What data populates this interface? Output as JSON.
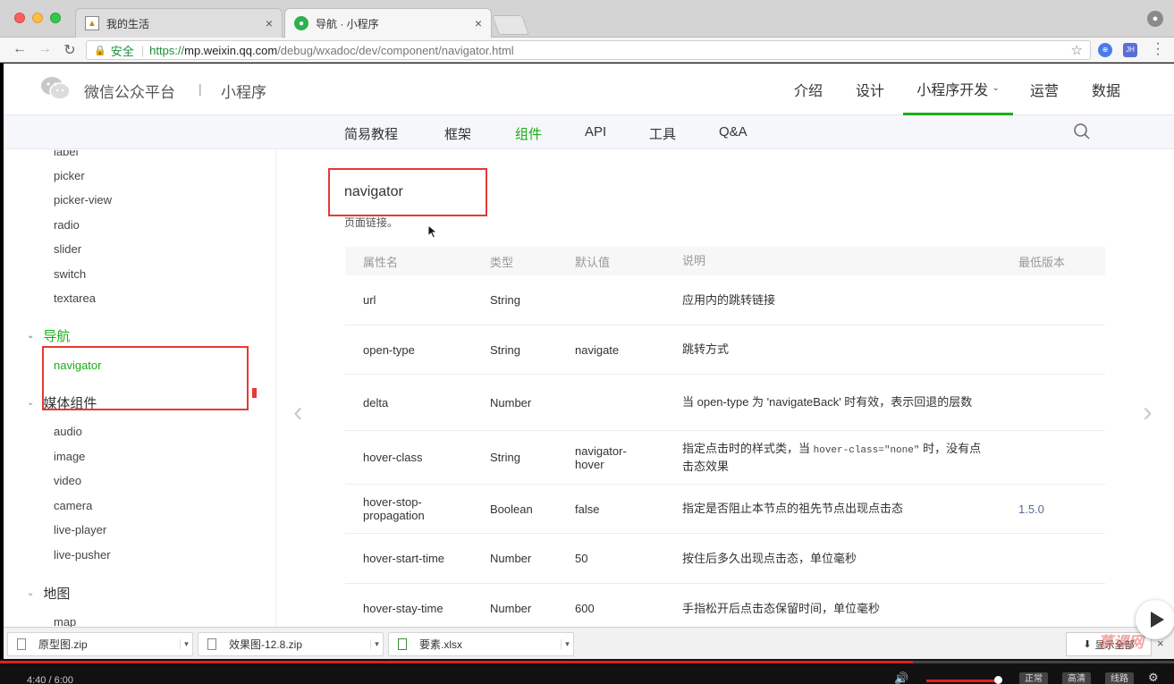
{
  "browser": {
    "tabs": [
      {
        "title": "我的生活",
        "close": "×"
      },
      {
        "title": "导航 · 小程序",
        "close": "×"
      }
    ],
    "secure_label": "安全",
    "url": {
      "proto": "https://",
      "host": "mp.weixin.qq.com",
      "path": "/debug/wxadoc/dev/component/navigator.html"
    },
    "ext_1": "⊕",
    "ext_2": "JH"
  },
  "site": {
    "logo_text": "微信公众平台",
    "logo_sep": "|",
    "logo_sub": "小程序",
    "top_nav": [
      "介绍",
      "设计",
      "小程序开发",
      "运营",
      "数据"
    ],
    "sub_nav": [
      "简易教程",
      "框架",
      "组件",
      "API",
      "工具",
      "Q&A"
    ]
  },
  "sidebar": {
    "top_partial": "label",
    "items_form": [
      "picker",
      "picker-view",
      "radio",
      "slider",
      "switch",
      "textarea"
    ],
    "group_nav": "导航",
    "items_nav": [
      "navigator"
    ],
    "group_media": "媒体组件",
    "items_media": [
      "audio",
      "image",
      "video",
      "camera",
      "live-player",
      "live-pusher"
    ],
    "group_map": "地图",
    "bottom_partial": "map"
  },
  "doc": {
    "title": "navigator",
    "desc": "页面链接。",
    "headers": [
      "属性名",
      "类型",
      "默认值",
      "说明",
      "最低版本"
    ],
    "rows": [
      {
        "name": "url",
        "type": "String",
        "default": "",
        "desc": "应用内的跳转链接",
        "version": ""
      },
      {
        "name": "open-type",
        "type": "String",
        "default": "navigate",
        "desc": "跳转方式",
        "version": ""
      },
      {
        "name": "delta",
        "type": "Number",
        "default": "",
        "desc": "当 open-type 为 'navigateBack' 时有效，表示回退的层数",
        "version": ""
      },
      {
        "name": "hover-class",
        "type": "String",
        "default": "navigator-hover",
        "desc_pre": "指定点击时的样式类，当 ",
        "desc_code": "hover-class=\"none\"",
        "desc_post": " 时，没有点击态效果",
        "version": ""
      },
      {
        "name": "hover-stop-propagation",
        "type": "Boolean",
        "default": "false",
        "desc": "指定是否阻止本节点的祖先节点出现点击态",
        "version": "1.5.0"
      },
      {
        "name": "hover-start-time",
        "type": "Number",
        "default": "50",
        "desc": "按住后多久出现点击态，单位毫秒",
        "version": ""
      },
      {
        "name": "hover-stay-time",
        "type": "Number",
        "default": "600",
        "desc": "手指松开后点击态保留时间，单位毫秒",
        "version": ""
      }
    ]
  },
  "downloads": {
    "files": [
      "原型图.zip",
      "效果图-12.8.zip",
      "要素.xlsx"
    ],
    "menu_glyph": "▾",
    "show_all": "显示全部",
    "close": "×"
  },
  "watermark": "慕课网",
  "player": {
    "time": "4:40 / 6:00",
    "progress_fraction": 0.7778,
    "volume_fraction": 0.95,
    "quality": [
      "正常",
      "高清",
      "线路"
    ]
  }
}
